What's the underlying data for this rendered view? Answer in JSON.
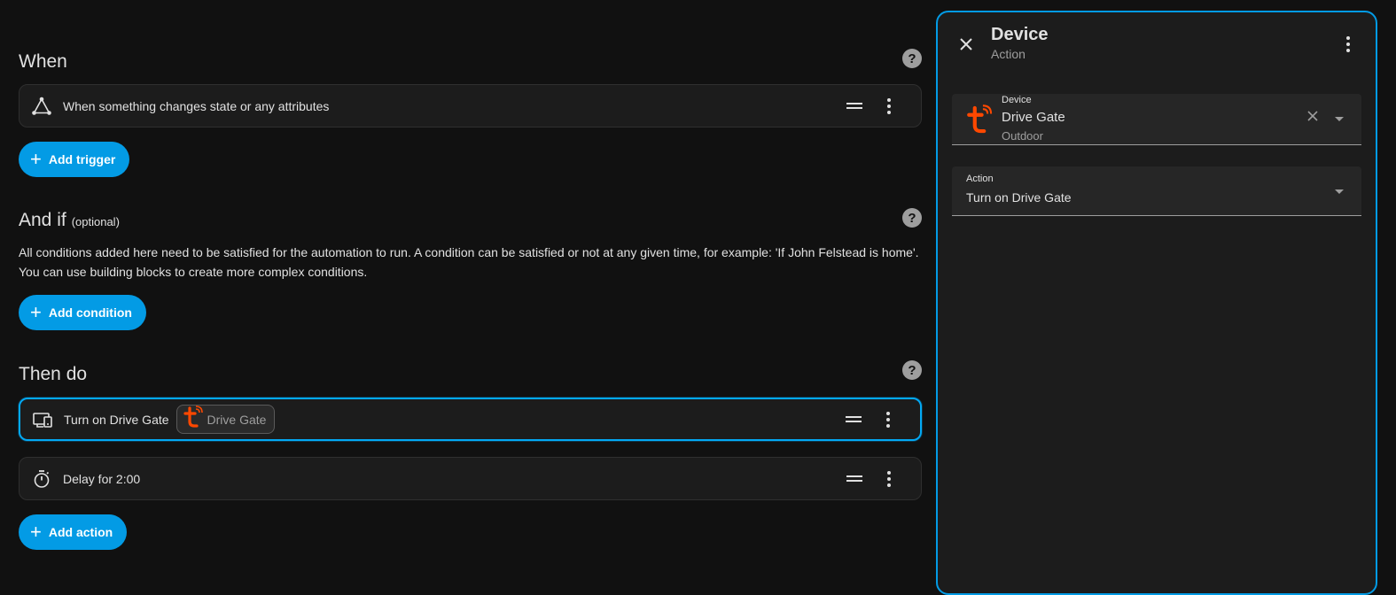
{
  "when": {
    "title": "When",
    "trigger_label": "When something changes state or any attributes",
    "add_button": "Add trigger"
  },
  "and_if": {
    "title": "And if",
    "optional": "(optional)",
    "description_line1": "All conditions added here need to be satisfied for the automation to run. A condition can be satisfied or not at any given time, for example: 'If John Felstead is home'.",
    "description_line2": "You can use building blocks to create more complex conditions.",
    "add_button": "Add condition"
  },
  "then_do": {
    "title": "Then do",
    "actions": [
      {
        "label": "Turn on Drive Gate",
        "chip": "Drive Gate",
        "icon": "device-icon"
      },
      {
        "label": "Delay for 2:00",
        "icon": "timer-icon"
      }
    ],
    "add_button": "Add action"
  },
  "panel": {
    "title": "Device",
    "subtitle": "Action",
    "device_field": {
      "caption": "Device",
      "value": "Drive Gate",
      "area": "Outdoor"
    },
    "action_field": {
      "caption": "Action",
      "value": "Turn on Drive Gate"
    }
  },
  "colors": {
    "accent": "#03a9f4",
    "button": "#039be5",
    "tuya_brand": "#ff4800",
    "background": "#111111",
    "card": "#1c1c1c"
  }
}
